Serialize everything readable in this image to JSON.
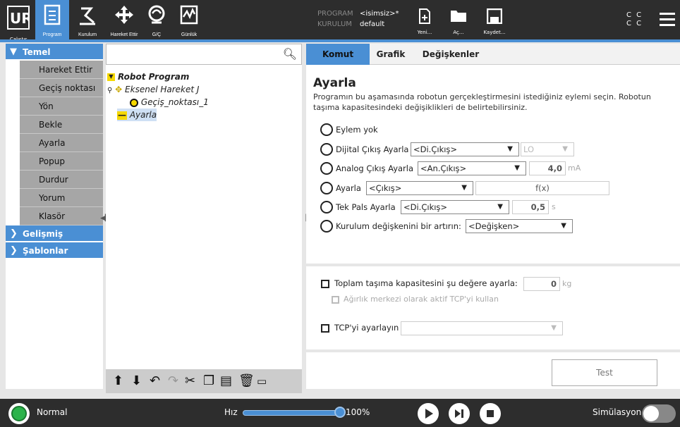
{
  "header": {
    "nav": [
      {
        "label": "Çalıştır",
        "icon": "ur-logo-icon"
      },
      {
        "label": "Program",
        "icon": "program-icon"
      },
      {
        "label": "Kurulum",
        "icon": "installation-icon"
      },
      {
        "label": "Hareket Ettir",
        "icon": "move-icon"
      },
      {
        "label": "G/Ç",
        "icon": "io-icon"
      },
      {
        "label": "Günlük",
        "icon": "log-icon"
      }
    ],
    "program_key": "PROGRAM",
    "program_value": "<isimsiz>*",
    "install_key": "KURULUM",
    "install_value": "default",
    "file": {
      "new": "Yeni...",
      "open": "Aç...",
      "save": "Kaydet..."
    },
    "cc_top": "C C",
    "cc_bottom": "C C"
  },
  "left": {
    "temel": "Temel",
    "items": [
      "Hareket Ettir",
      "Geçiş noktası",
      "Yön",
      "Bekle",
      "Ayarla",
      "Popup",
      "Durdur",
      "Yorum",
      "Klasör"
    ],
    "gelismis": "Gelişmiş",
    "sablonlar": "Şablonlar"
  },
  "tree": {
    "root": "Robot Program",
    "movej": "Eksenel Hareket J",
    "waypoint": "Geçiş_noktası_1",
    "set": "Ayarla"
  },
  "tabs": [
    "Komut",
    "Grafik",
    "Değişkenler"
  ],
  "command": {
    "title": "Ayarla",
    "desc": "Programın bu aşamasında robotun gerçekleştirmesini istediğiniz eylemi seçin. Robotun taşıma kapasitesindeki değişiklikleri de belirtebilirsiniz.",
    "opt_none": "Eylem yok",
    "opt_digital": "Dijital Çıkış Ayarla",
    "digital_select": "<Di.Çıkış>",
    "digital_value": "LO",
    "opt_analog": "Analog Çıkış Ayarla",
    "analog_select": "<An.Çıkış>",
    "analog_value": "4,0",
    "analog_unit": "mA",
    "opt_set": "Ayarla",
    "set_select": "<Çıkış>",
    "set_expr": "f(x)",
    "opt_pulse": "Tek Pals Ayarla",
    "pulse_select": "<Di.Çıkış>",
    "pulse_value": "0,5",
    "pulse_unit": "s",
    "opt_increment": "Kurulum değişkenini bir artırın:",
    "increment_select": "<Değişken>",
    "payload_label": "Toplam taşıma kapasitesini şu değere ayarla:",
    "payload_value": "0",
    "payload_unit": "kg",
    "cog_label": "Ağırlık merkezi olarak aktif TCP'yi kullan",
    "tcp_label": "TCP'yi ayarlayın",
    "test": "Test"
  },
  "footer": {
    "status": "Normal",
    "speed_label": "Hız",
    "speed_value": "100%",
    "speed_fraction": 1.0,
    "simulation": "Simülasyon"
  }
}
